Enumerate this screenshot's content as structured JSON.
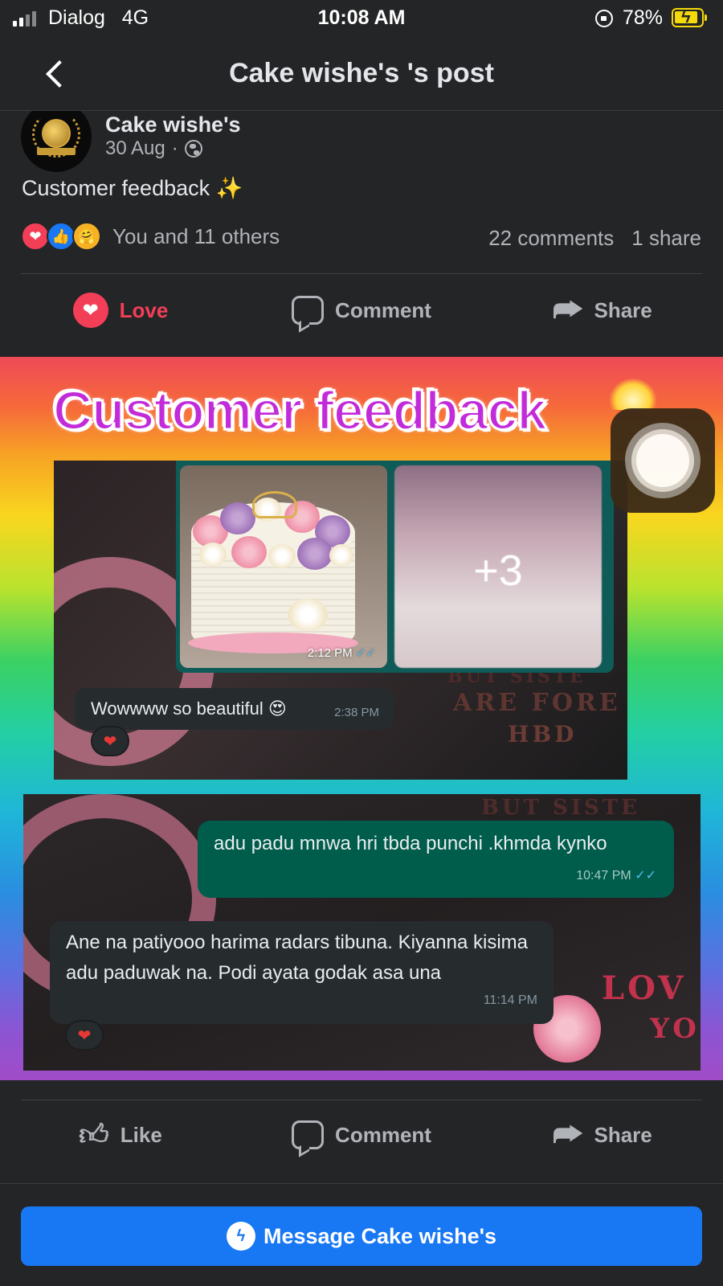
{
  "status_bar": {
    "carrier": "Dialog",
    "network": "4G",
    "time": "10:08 AM",
    "battery": "78%"
  },
  "header": {
    "title": "Cake wishe's 's post"
  },
  "post": {
    "author": "Cake wishe's",
    "date": "30 Aug",
    "separator": "·",
    "caption": "Customer feedback",
    "reactions_text": "You and 11 others",
    "comments_count": "22 comments",
    "shares_count": "1 share"
  },
  "actions_top": {
    "love": "Love",
    "comment": "Comment",
    "share": "Share"
  },
  "image": {
    "headline": "Customer feedback",
    "shot1": {
      "photo_time": "2:12 PM",
      "more_count": "+3",
      "message": "Wowwww so beautiful 😍",
      "message_time": "2:38 PM",
      "bg_text_1": "BUT SISTE",
      "bg_text_2": "ARE FORE",
      "bg_text_3": "HBD"
    },
    "shot2": {
      "out_message": "adu padu mnwa hri tbda punchi .khmda kynko",
      "out_time": "10:47 PM",
      "in_message": "Ane na patiyooo harima radars tibuna. Kiyanna kisima adu paduwak na. Podi ayata godak asa una",
      "in_time": "11:14 PM",
      "bg_text_1": "BUT SISTE",
      "bg_text_2": "LOV",
      "bg_text_3": "YOU"
    }
  },
  "actions_bottom": {
    "like": "Like",
    "comment": "Comment",
    "share": "Share"
  },
  "messenger": {
    "label": "Message Cake wishe's"
  },
  "colors": {
    "love": "#f33e58",
    "like_blue": "#1877f2",
    "background": "#242526",
    "whatsapp_out": "#005c4b"
  }
}
